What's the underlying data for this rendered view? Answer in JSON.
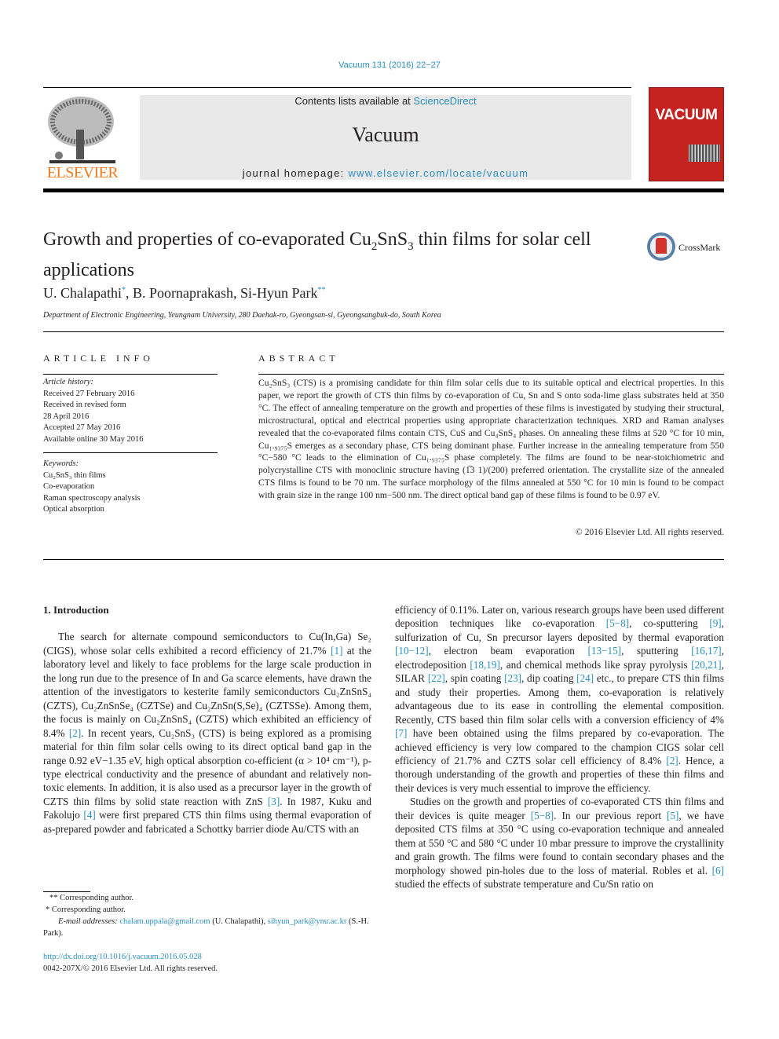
{
  "journal_ref": "Vacuum 131 (2016) 22−27",
  "header": {
    "publisher_logo_text": "ELSEVIER",
    "contents_prefix": "Contents lists available at ",
    "contents_link": "ScienceDirect",
    "journal_name": "Vacuum",
    "homepage_prefix": "journal homepage: ",
    "homepage_link": "www.elsevier.com/locate/vacuum",
    "cover_title": "VACUUM"
  },
  "article": {
    "title_part1": "Growth and properties of co-evaporated Cu",
    "title_sub1": "2",
    "title_part2": "SnS",
    "title_sub2": "3",
    "title_part3": " thin films for solar cell applications",
    "crossmark_label": "CrossMark",
    "authors": [
      {
        "name": "U. Chalapathi",
        "mark": "*",
        "sep": ", "
      },
      {
        "name": "B. Poornaprakash",
        "mark": "",
        "sep": ", "
      },
      {
        "name": "Si-Hyun Park",
        "mark": "**",
        "sep": ""
      }
    ],
    "affiliation": "Department of Electronic Engineering, Yeungnam University, 280 Daehak-ro, Gyeongsan-si, Gyeongsangbuk-do, South Korea"
  },
  "article_info": {
    "heading": "ARTICLE INFO",
    "history_label": "Article history:",
    "history": [
      "Received 27 February 2016",
      "Received in revised form",
      "28 April 2016",
      "Accepted 27 May 2016",
      "Available online 30 May 2016"
    ],
    "keywords_label": "Keywords:",
    "keywords": [
      "Cu₂SnS₃ thin films",
      "Co-evaporation",
      "Raman spectroscopy analysis",
      "Optical absorption"
    ]
  },
  "abstract": {
    "heading": "ABSTRACT",
    "text": "Cu₂SnS₃ (CTS) is a promising candidate for thin film solar cells due to its suitable optical and electrical properties. In this paper, we report the growth of CTS thin films by co-evaporation of Cu, Sn and S onto soda-lime glass substrates held at 350 °C. The effect of annealing temperature on the growth and properties of these films is investigated by studying their structural, microstructural, optical and electrical properties using appropriate characterization techniques. XRD and Raman analyses revealed that the co-evaporated films contain CTS, CuS and Cu₄SnS₄ phases. On annealing these films at 520 °C for 10 min, Cu₁.₉₃₇₅S emerges as a secondary phase, CTS being dominant phase. Further increase in the annealing temperature from 550 °C−580 °C leads to the elimination of Cu₁.₉₃₇₅S phase completely. The films are found to be near-stoichiometric and polycrystalline CTS with monoclinic structure having (Ė1̅3̅1) ... ",
    "text_clean": "Cu₂SnS₃ (CTS) is a promising candidate for thin film solar cells due to its suitable optical and electrical properties. In this paper, we report the growth of CTS thin films by co-evaporation of Cu, Sn and S onto soda-lime glass substrates held at 350 °C. The effect of annealing temperature on the growth and properties of these films is investigated by studying their structural, microstructural, optical and electrical properties using appropriate characterization techniques. XRD and Raman analyses revealed that the co-evaporated films contain CTS, CuS and Cu₄SnS₄ phases. On annealing these films at 520 °C for 10 min, Cu₁.₉₃₇₅S emerges as a secondary phase, CTS being dominant phase. Further increase in the annealing temperature from 550 °C−580 °C leads to the elimination of Cu₁.₉₃₇₅S phase completely. The films are found to be near-stoichiometric and polycrystalline CTS with monoclinic structure having (1̅3 1)/(200) preferred orientation. The crystallite size of the annealed CTS films is found to be 70 nm. The surface morphology of the films annealed at 550 °C for 10 min is found to be compact with grain size in the range 100 nm−500 nm. The direct optical band gap of these films is found to be 0.97 eV.",
    "copyright": "© 2016 Elsevier Ltd. All rights reserved."
  },
  "introduction": {
    "heading": "1.  Introduction",
    "left_paragraph": [
      {
        "t": "The search for alternate compound semiconductors to Cu(In,Ga) Se₂ (CIGS), whose solar cells exhibited a record efficiency of 21.7% "
      },
      {
        "c": "[1]"
      },
      {
        "t": " at the laboratory level and likely to face problems for the large scale production in the long run due to the presence of In and Ga scarce elements, have drawn the attention of the investigators to kesterite family semiconductors Cu₂ZnSnS₄ (CZTS), Cu₂ZnSnSe₄ (CZTSe) and Cu₂ZnSn(S,Se)₄ (CZTSSe). Among them, the focus is mainly on Cu₂ZnSnS₄ (CZTS) which exhibited an efficiency of 8.4% "
      },
      {
        "c": "[2]"
      },
      {
        "t": ". In recent years, Cu₂SnS₃ (CTS) is being explored as a promising material for thin film solar cells owing to its direct optical band gap in the range 0.92 eV−1.35 eV, high optical absorption co-efficient (α > 10⁴ cm⁻¹), p-type electrical conductivity and the presence of abundant and relatively non-toxic elements. In addition, it is also used as a precursor layer in the growth of CZTS thin films by solid state reaction with ZnS "
      },
      {
        "c": "[3]"
      },
      {
        "t": ". In 1987, Kuku and Fakolujo "
      },
      {
        "c": "[4]"
      },
      {
        "t": " were first prepared CTS thin films using thermal evaporation of as-prepared powder and fabricated a Schottky barrier diode Au/CTS with an"
      }
    ],
    "right_paragraph_1": [
      {
        "t": "efficiency of 0.11%. Later on, various research groups have been used different deposition techniques like co-evaporation "
      },
      {
        "c": "[5−8]"
      },
      {
        "t": ", co-sputtering "
      },
      {
        "c": "[9]"
      },
      {
        "t": ", sulfurization of Cu, Sn precursor layers deposited by thermal evaporation "
      },
      {
        "c": "[10−12]"
      },
      {
        "t": ", electron beam evaporation "
      },
      {
        "c": "[13−15]"
      },
      {
        "t": ", sputtering "
      },
      {
        "c": "[16,17]"
      },
      {
        "t": ", electrodeposition "
      },
      {
        "c": "[18,19]"
      },
      {
        "t": ", and chemical methods like spray pyrolysis "
      },
      {
        "c": "[20,21]"
      },
      {
        "t": ", SILAR "
      },
      {
        "c": "[22]"
      },
      {
        "t": ", spin coating "
      },
      {
        "c": "[23]"
      },
      {
        "t": ", dip coating "
      },
      {
        "c": "[24]"
      },
      {
        "t": " etc., to prepare CTS thin films and study their properties. Among them, co-evaporation is relatively advantageous due to its ease in controlling the elemental composition. Recently, CTS based thin film solar cells with a conversion efficiency of 4% "
      },
      {
        "c": "[7]"
      },
      {
        "t": " have been obtained using the films prepared by co-evaporation. The achieved efficiency is very low compared to the champion CIGS solar cell efficiency of 21.7% and CZTS solar cell efficiency of 8.4% "
      },
      {
        "c": "[2]"
      },
      {
        "t": ". Hence, a thorough understanding of the growth and properties of these thin films and their devices is very much essential to improve the efficiency."
      }
    ],
    "right_paragraph_2": [
      {
        "t": "Studies on the growth and properties of co-evaporated CTS thin films and their devices is quite meager "
      },
      {
        "c": "[5−8]"
      },
      {
        "t": ". In our previous report "
      },
      {
        "c": "[5]"
      },
      {
        "t": ", we have deposited CTS films at 350 °C using co-evaporation technique and annealed them at 550 °C and 580 °C under 10 mbar pressure to improve the crystallinity and grain growth. The films were found to contain secondary phases and the morphology showed pin-holes due to the loss of material. Robles et al. "
      },
      {
        "c": "[6]"
      },
      {
        "t": " studied the effects of substrate temperature and Cu/Sn ratio on"
      }
    ]
  },
  "footnotes": {
    "note1": "** Corresponding author.",
    "note2": "* Corresponding author.",
    "email_label": "E-mail addresses: ",
    "email1": "chalam.uppala@gmail.com",
    "email1_owner": " (U. Chalapathi), ",
    "email2": "sihyun_park@ynu.ac.kr",
    "email2_owner": " (S.-H. Park).",
    "doi": "http://dx.doi.org/10.1016/j.vacuum.2016.05.028",
    "issn_copyright": "0042-207X/© 2016 Elsevier Ltd. All rights reserved."
  }
}
